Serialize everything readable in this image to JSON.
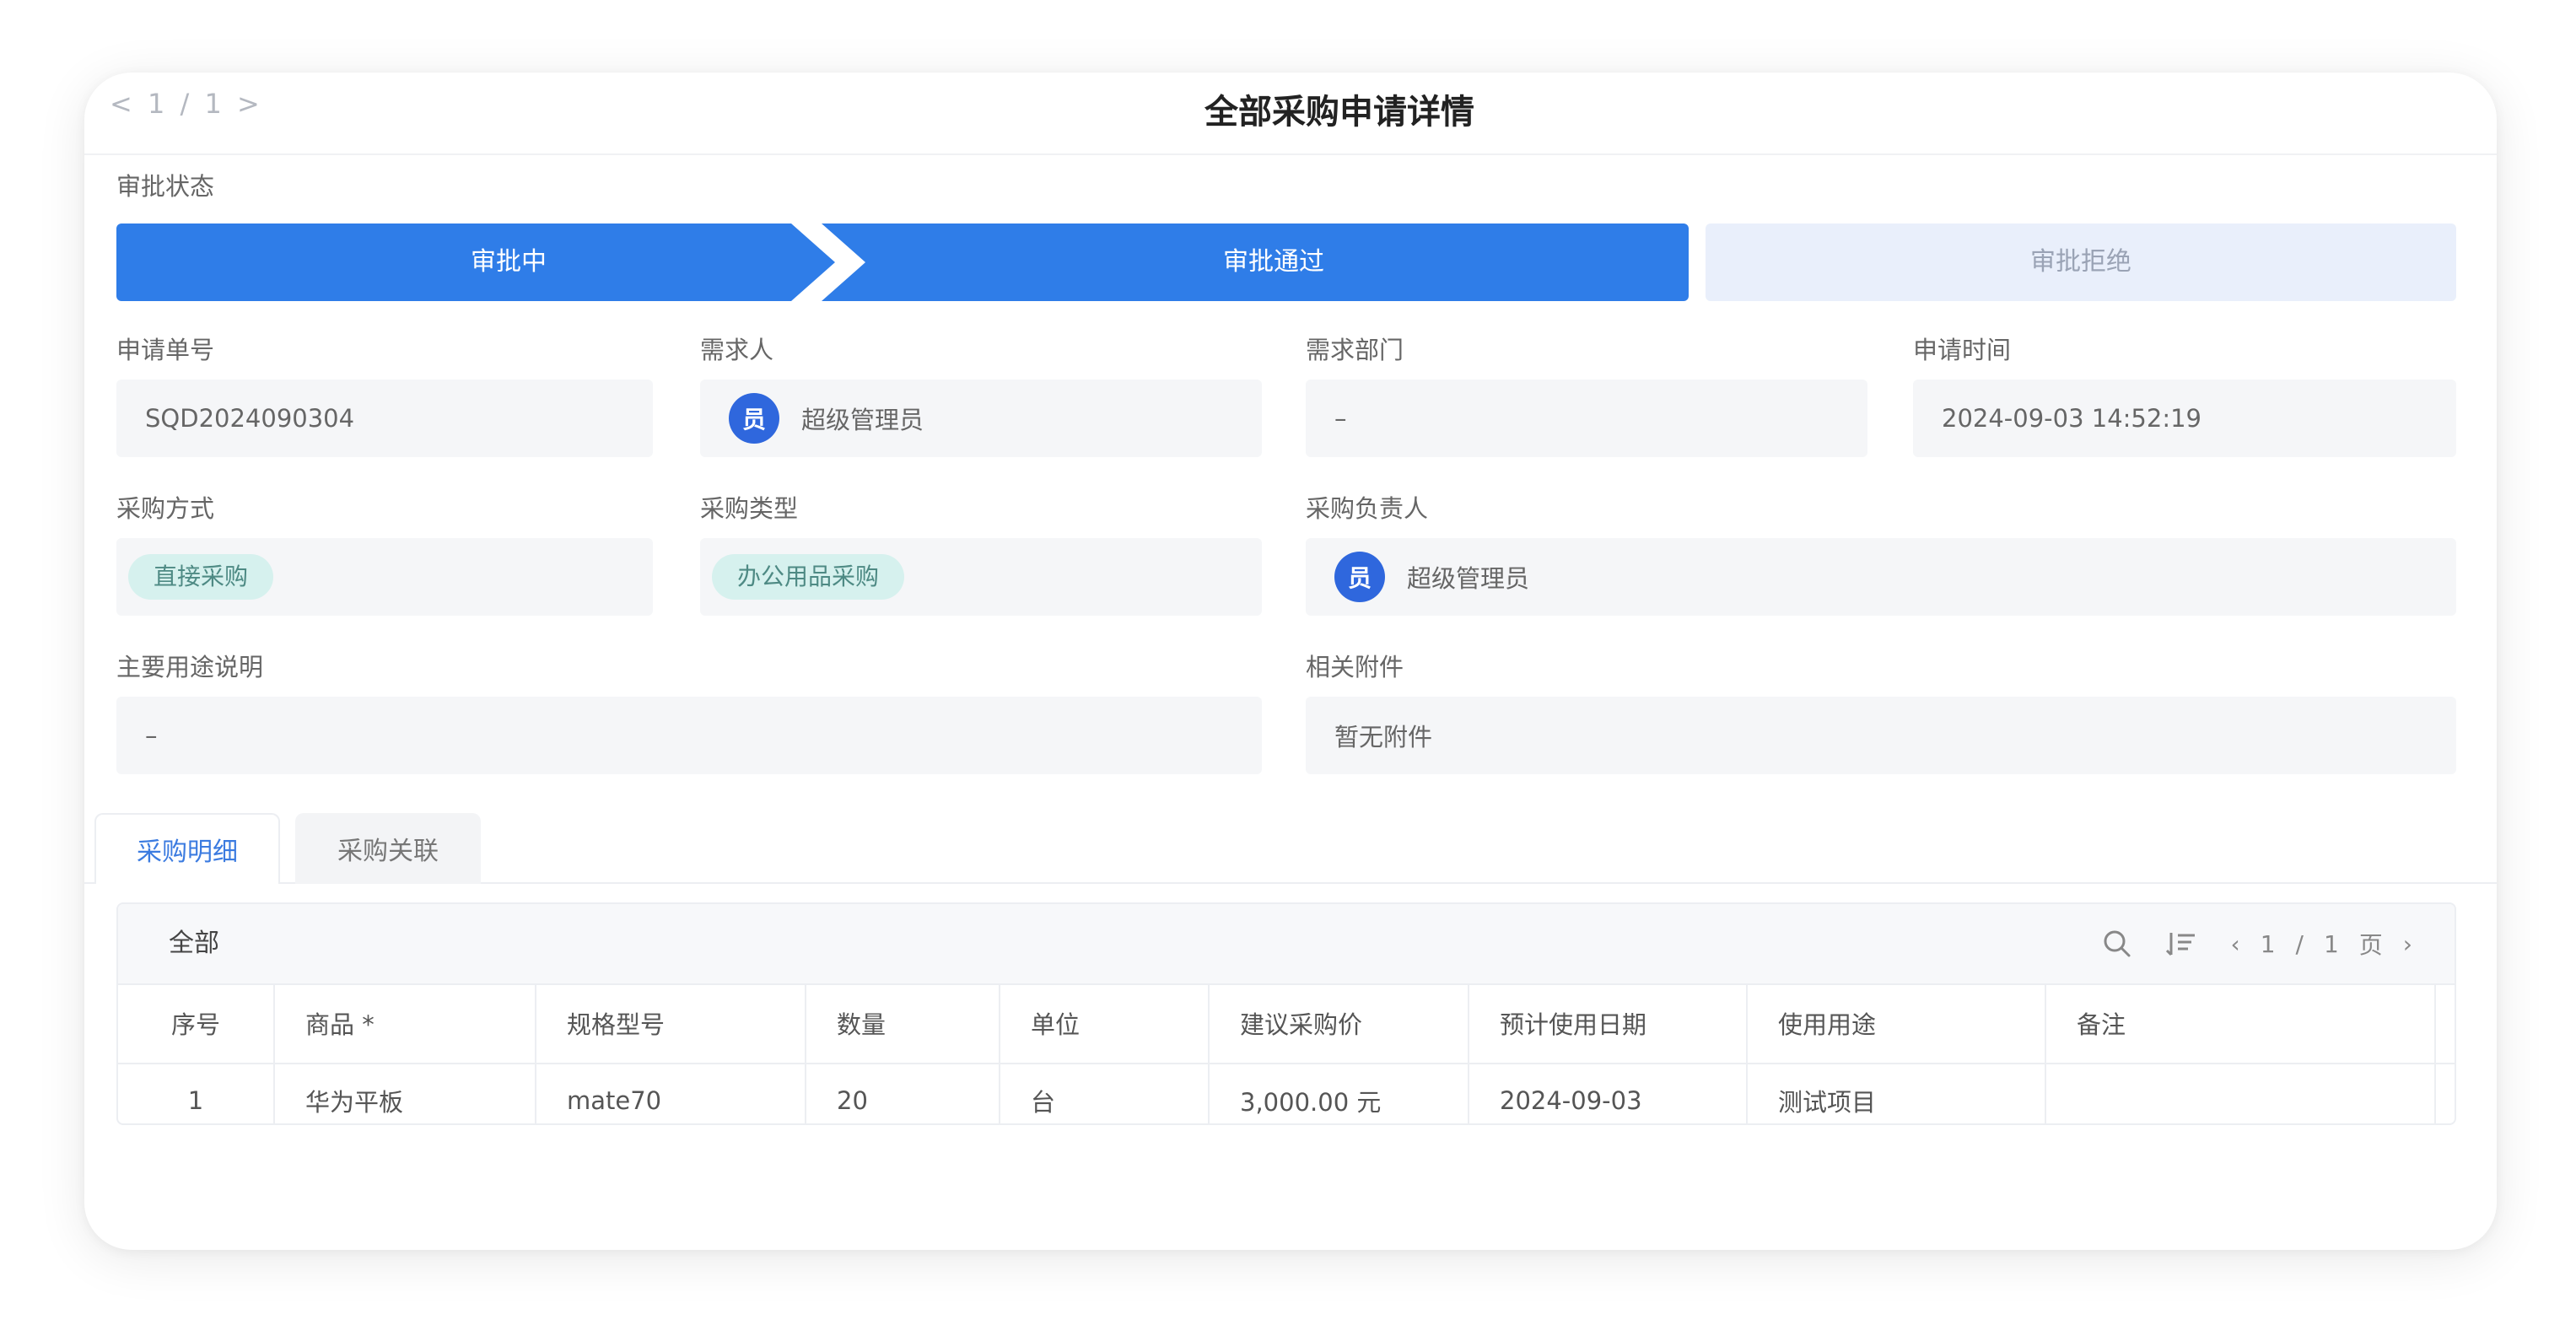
{
  "header": {
    "pager": "< 1 / 1 >",
    "title": "全部采购申请详情"
  },
  "approval": {
    "label": "审批状态",
    "steps": [
      "审批中",
      "审批通过",
      "审批拒绝"
    ]
  },
  "fields": {
    "order_no": {
      "label": "申请单号",
      "value": "SQD2024090304"
    },
    "requester": {
      "label": "需求人",
      "avatar": "员",
      "value": "超级管理员"
    },
    "department": {
      "label": "需求部门",
      "value": "–"
    },
    "apply_time": {
      "label": "申请时间",
      "value": "2024-09-03 14:52:19"
    },
    "purchase_method": {
      "label": "采购方式",
      "value": "直接采购"
    },
    "purchase_type": {
      "label": "采购类型",
      "value": "办公用品采购"
    },
    "purchase_owner": {
      "label": "采购负责人",
      "avatar": "员",
      "value": "超级管理员"
    },
    "usage": {
      "label": "主要用途说明",
      "value": "–"
    },
    "attachments": {
      "label": "相关附件",
      "value": "暂无附件"
    }
  },
  "tabs": [
    "采购明细",
    "采购关联"
  ],
  "table": {
    "filter": "全部",
    "pager": {
      "current": "1",
      "sep": "/",
      "total": "1",
      "unit": "页"
    },
    "icons": {
      "search": "search-icon",
      "settings": "column-settings-icon"
    },
    "columns": [
      "序号",
      "商品 *",
      "规格型号",
      "数量",
      "单位",
      "建议采购价",
      "预计使用日期",
      "使用用途",
      "备注"
    ],
    "rows": [
      [
        "1",
        "华为平板",
        "mate70",
        "20",
        "台",
        "3,000.00 元",
        "2024-09-03",
        "测试项目",
        ""
      ]
    ]
  },
  "colors": {
    "primary": "#2f7de8",
    "step_inactive": "#e9effb",
    "tag_bg": "#d6f1ee",
    "tag_text": "#4e8a84"
  }
}
